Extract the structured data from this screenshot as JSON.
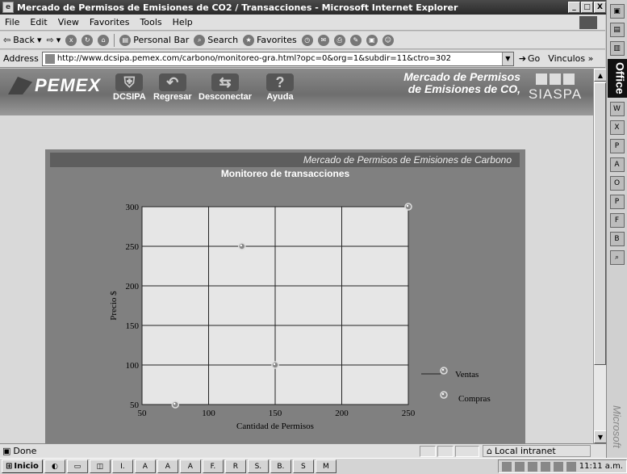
{
  "window": {
    "title": "Mercado de Permisos de Emisiones de CO2 / Transacciones - Microsoft Internet Explorer",
    "minimize": "_",
    "maximize": "□",
    "close": "X"
  },
  "menu": {
    "items": [
      "File",
      "Edit",
      "View",
      "Favorites",
      "Tools",
      "Help"
    ]
  },
  "toolbar": {
    "back": "Back",
    "personal_bar": "Personal Bar",
    "search": "Search",
    "favorites": "Favorites"
  },
  "address": {
    "label": "Address",
    "url": "http://www.dcsipa.pemex.com/carbono/monitoreo-gra.html?opc=0&org=1&subdir=11&ctro=302",
    "go": "Go",
    "links": "Vinculos »"
  },
  "header": {
    "logo": "PEMEX",
    "nav": [
      {
        "label": "DCSIPA",
        "icon": "shield-icon"
      },
      {
        "label": "Regresar",
        "icon": "back-arrow-icon"
      },
      {
        "label": "Desconectar",
        "icon": "disconnect-icon"
      },
      {
        "label": "Ayuda",
        "icon": "help-icon"
      }
    ],
    "banner_line1": "Mercado de Permisos",
    "banner_line2": "de Emisiones de CO,",
    "siaspa": "SIASPA"
  },
  "panel": {
    "header": "Mercado de Permisos de Emisiones de Carbono",
    "subtitle": "Monitoreo de transacciones"
  },
  "chart_data": {
    "type": "scatter",
    "xlabel": "Cantidad de Permisos",
    "ylabel": "Precio $",
    "xlim": [
      50,
      250
    ],
    "ylim": [
      50,
      300
    ],
    "x_ticks": [
      50,
      100,
      150,
      200,
      250
    ],
    "y_ticks": [
      50,
      100,
      150,
      200,
      250,
      300
    ],
    "grid": true,
    "legend_position": "bottom-right",
    "series": [
      {
        "name": "Ventas",
        "points": [
          [
            125,
            250
          ],
          [
            250,
            300
          ]
        ]
      },
      {
        "name": "Compras",
        "points": [
          [
            75,
            50
          ],
          [
            150,
            100
          ]
        ]
      }
    ]
  },
  "status": {
    "text": "Done",
    "zone": "Local intranet"
  },
  "taskbar": {
    "start": "Inicio",
    "tasks": [
      "I.",
      "A",
      "A",
      "A",
      "F.",
      "R",
      "S.",
      "B.",
      "S",
      "M"
    ],
    "clock": "11:11 a.m."
  },
  "officebar": {
    "office_label": "Office",
    "ms_label": "Microsoft"
  },
  "colors": {
    "plot_bg": "#e6e6e6",
    "panel_bg": "#808080",
    "header_bar": "#5e5e5e",
    "marker": "#888888"
  }
}
